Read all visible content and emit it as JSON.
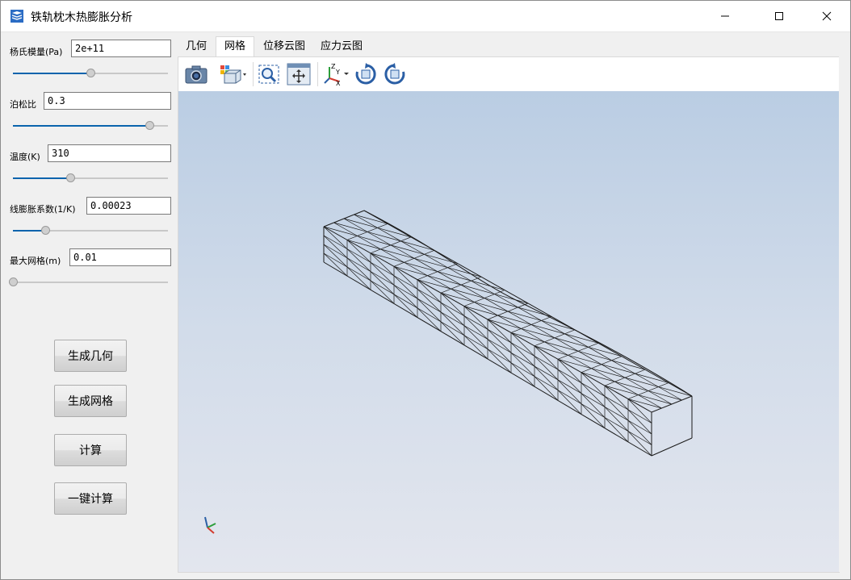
{
  "window": {
    "title": "铁轨枕木热膨胀分析",
    "controls": [
      "minimize-button",
      "maximize-button",
      "close-button"
    ]
  },
  "params": [
    {
      "label": "杨氏模量(Pa)",
      "value": "2e+11",
      "slider_fraction": 0.5
    },
    {
      "label": "泊松比",
      "value": "0.3",
      "slider_fraction": 0.88
    },
    {
      "label": "温度(K)",
      "value": "310",
      "slider_fraction": 0.37
    },
    {
      "label": "线膨胀系数(1/K)",
      "value": "0.00023",
      "slider_fraction": 0.21
    },
    {
      "label": "最大网格(m)",
      "value": "0.01",
      "slider_fraction": 0.0
    }
  ],
  "buttons": {
    "gen_geometry": "生成几何",
    "gen_mesh": "生成网格",
    "compute": "计算",
    "one_click": "一键计算"
  },
  "tabs": [
    {
      "label": "几何",
      "active": false
    },
    {
      "label": "网格",
      "active": true
    },
    {
      "label": "位移云图",
      "active": false
    },
    {
      "label": "应力云图",
      "active": false
    }
  ],
  "toolbar_icons": [
    "camera-icon",
    "view-cube-icon",
    "zoom-box-icon",
    "fit-all-icon",
    "axes-view-icon",
    "rotate-cw-icon",
    "rotate-ccw-icon"
  ],
  "colors": {
    "accent": "#0a64ad",
    "viewport_top": "#bacde3",
    "viewport_bottom": "#e3e6ee"
  }
}
